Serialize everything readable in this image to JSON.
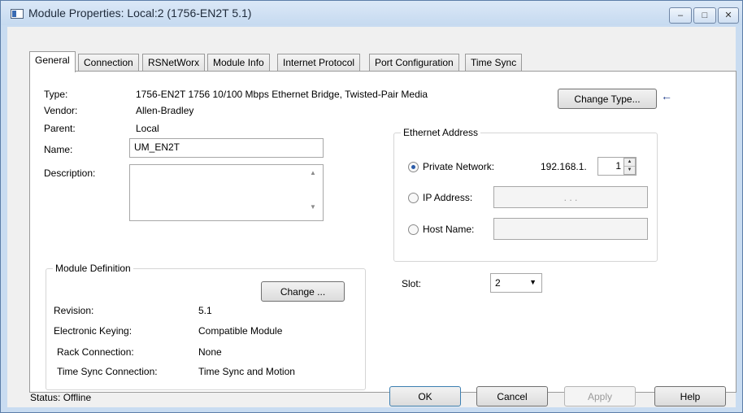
{
  "window": {
    "title": "Module Properties: Local:2 (1756-EN2T 5.1)",
    "controls": {
      "minimize": "–",
      "maximize": "□",
      "close": "✕"
    }
  },
  "tabs": [
    "General",
    "Connection",
    "RSNetWorx",
    "Module Info",
    "Internet Protocol",
    "Port Configuration",
    "Time Sync"
  ],
  "general": {
    "type_label": "Type:",
    "type_value": "1756-EN2T 1756 10/100 Mbps Ethernet Bridge, Twisted-Pair Media",
    "vendor_label": "Vendor:",
    "vendor_value": "Allen-Bradley",
    "parent_label": "Parent:",
    "parent_value": "Local",
    "name_label": "Name:",
    "name_value": "UM_EN2T",
    "description_label": "Description:",
    "description_value": "",
    "change_type_button": "Change Type...",
    "arrow_glyph": "←"
  },
  "ethernet": {
    "group_title": "Ethernet Address",
    "private_network_label": "Private Network:",
    "private_network_prefix": "192.168.1.",
    "private_network_value": "1",
    "ip_address_label": "IP Address:",
    "ip_dots": ".        .        .",
    "host_name_label": "Host Name:",
    "selected": "private_network"
  },
  "slot": {
    "label": "Slot:",
    "value": "2"
  },
  "module_definition": {
    "group_title": "Module Definition",
    "change_button": "Change ...",
    "revision_label": "Revision:",
    "revision_value": "5.1",
    "keying_label": "Electronic Keying:",
    "keying_value": "Compatible Module",
    "rack_label": "Rack Connection:",
    "rack_value": "None",
    "timesync_label": "Time Sync Connection:",
    "timesync_value": "Time Sync and Motion"
  },
  "status": {
    "text": "Status:  Offline"
  },
  "buttons": {
    "ok": "OK",
    "cancel": "Cancel",
    "apply": "Apply",
    "help": "Help"
  }
}
